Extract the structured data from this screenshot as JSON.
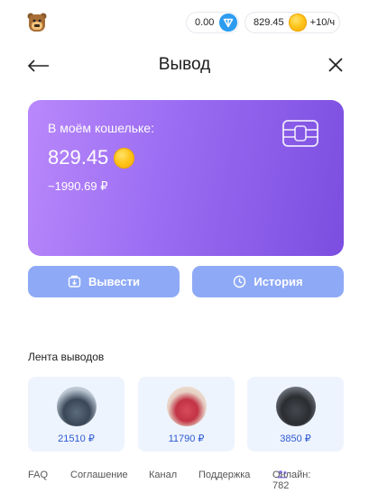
{
  "topbar": {
    "ton_balance": "0.00",
    "coin_balance": "829.45",
    "rate": "+10/ч"
  },
  "header": {
    "title": "Вывод"
  },
  "wallet_card": {
    "label": "В моём кошельке:",
    "amount": "829.45",
    "fiat": "~1990.69 ₽"
  },
  "actions": {
    "withdraw_label": "Вывести",
    "history_label": "История"
  },
  "feed": {
    "title": "Лента выводов",
    "items": [
      {
        "amount": "21510 ₽"
      },
      {
        "amount": "11790 ₽"
      },
      {
        "amount": "3850 ₽"
      }
    ]
  },
  "footer": {
    "faq": "FAQ",
    "agreement": "Соглашение",
    "channel": "Канал",
    "support": "Поддержка",
    "online": "Онлайн: 782"
  },
  "colors": {
    "accent_button": "#8ea9f6",
    "card_gradient_start": "#b988fb",
    "card_gradient_end": "#7c4ee0",
    "feed_card_bg": "#eef4fe",
    "amount_text": "#2d5bd1"
  },
  "icons": [
    "bear-logo-icon",
    "ton-icon",
    "coin-icon",
    "back-arrow-icon",
    "close-icon",
    "card-chip-icon",
    "wallet-icon",
    "clock-icon",
    "people-icon"
  ]
}
